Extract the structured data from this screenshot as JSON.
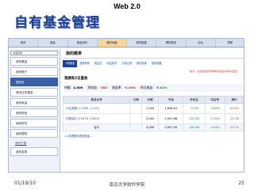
{
  "header": {
    "top_label": "Web 2.0",
    "title": "自有基金管理"
  },
  "nav": [
    "首页",
    "基金",
    "基金资讯",
    "我的地盘",
    "现时数据",
    "理财教室",
    "论坛",
    "帮助"
  ],
  "sidebar": {
    "select": "基金名称",
    "items": [
      "我的基金",
      "我的账户",
      "登陆名",
      "我关注的基金",
      "我的收益",
      "我的短信",
      "我的研究",
      "我的理财",
      "资讯下载",
      "我的发表"
    ],
    "active_index": 1
  },
  "main": {
    "panel_title": "我的概率",
    "tabs": [
      "+新基金",
      "查看所有",
      "收益日",
      "收益情况",
      "交易记录",
      "我的设置",
      "指标提醒"
    ],
    "notice": "提示：点击基金名称查看该基金的资料与配置",
    "section_title": "我拥有2支基金",
    "summary": [
      {
        "label": "份额：",
        "value": "4,000"
      },
      {
        "label": "净收益：",
        "value": "-182",
        "color": "red"
      },
      {
        "label": "收益率：",
        "value": "-4.54%",
        "color": "red"
      },
      {
        "label": "昨日收益：",
        "value": "-0.82%",
        "color": "green"
      }
    ],
    "table": {
      "headers": [
        "基金名称",
        "日期",
        "份额",
        "市值",
        "净收益",
        "收益率",
        "操作"
      ],
      "rows": [
        {
          "name": "兴业趋势 1.2780 -1.07%",
          "date": "",
          "shares": "2,000",
          "value": "1,836.81",
          "gain": "-73.67",
          "rate": "-3.89%",
          "op": "-24.59"
        },
        {
          "name": "华夏成长 2.0470 -0.82%",
          "date": "",
          "shares": "2,000",
          "value": "1,901.68",
          "gain": "-107.62",
          "rate": "-5.39%",
          "op": "-15.78"
        }
      ],
      "total": {
        "name": "合计",
        "shares": "4,000",
        "value": "3,837.50",
        "gain": "-181.69",
        "rate": "-4.54%",
        "op": "-15.79"
      }
    },
    "more_link": ">>查看更多我的基金..."
  },
  "footer": {
    "date": "01/19/10",
    "institution": "南京大学软件学院",
    "page": "25"
  }
}
